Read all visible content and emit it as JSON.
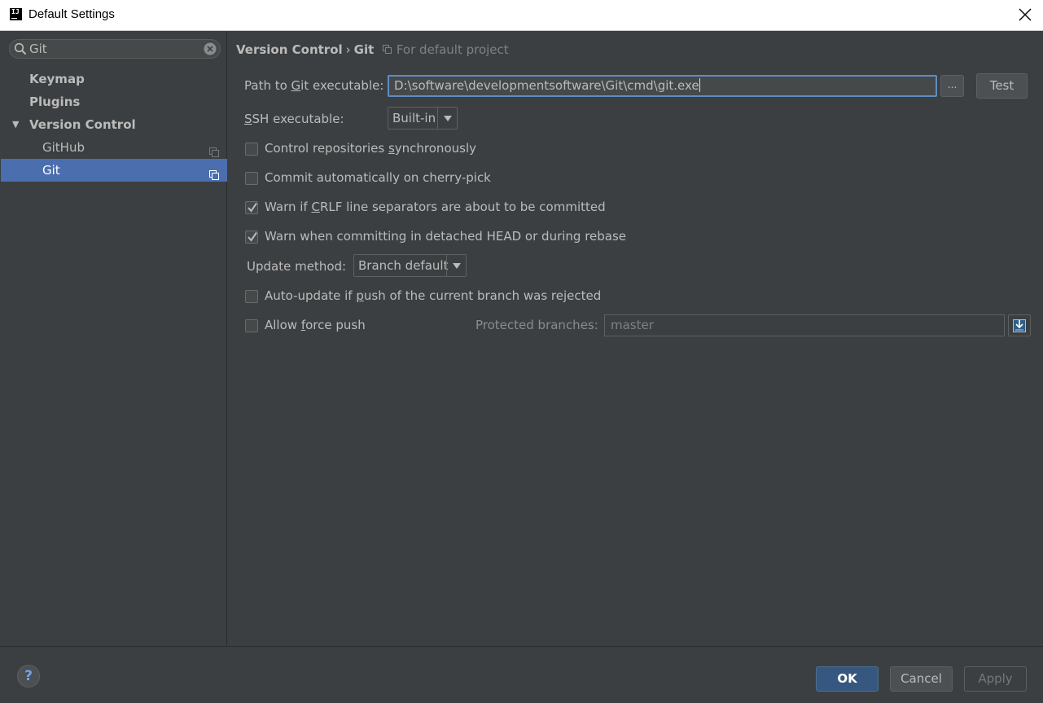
{
  "window": {
    "title": "Default Settings"
  },
  "search": {
    "value": "Git"
  },
  "sidebar": {
    "items": [
      {
        "label": "Keymap"
      },
      {
        "label": "Plugins"
      },
      {
        "label": "Version Control"
      },
      {
        "label": "GitHub"
      },
      {
        "label": "Git"
      }
    ]
  },
  "breadcrumb": {
    "section": "Version Control",
    "separator": "›",
    "page": "Git",
    "scope": "For default project"
  },
  "git": {
    "path_label_pre": "Path to ",
    "path_label_mnemonic": "G",
    "path_label_post": "it executable:",
    "path_value": "D:\\software\\developmentsoftware\\Git\\cmd\\git.exe",
    "browse_label": "...",
    "test_label": "Test",
    "ssh_label_mnemonic": "S",
    "ssh_label_post": "SH executable:",
    "ssh_value": "Built-in",
    "update_label": "Update method:",
    "update_value": "Branch default",
    "protected_label": "Protected branches:",
    "protected_value": "master"
  },
  "options": {
    "sync": {
      "pre": "Control repositories ",
      "mnemonic": "s",
      "post": "ynchronously",
      "checked": false
    },
    "cherry": {
      "label": "Commit automatically on cherry-pick",
      "checked": false
    },
    "crlf": {
      "pre": "Warn if ",
      "mnemonic": "C",
      "post": "RLF line separators are about to be committed",
      "checked": true
    },
    "detached": {
      "label": "Warn when committing in detached HEAD or during rebase",
      "checked": true
    },
    "autoupdate": {
      "pre": "Auto-update if ",
      "mnemonic": "p",
      "post": "ush of the current branch was rejected",
      "checked": false
    },
    "force": {
      "pre": "Allow ",
      "mnemonic": "f",
      "post": "orce push",
      "checked": false
    }
  },
  "footer": {
    "help_label": "?",
    "ok_label": "OK",
    "cancel_label": "Cancel",
    "apply_label": "Apply"
  },
  "colors": {
    "background": "#3c3f41",
    "selection": "#4b6eaf",
    "focus_border": "#5e8cc4",
    "ok_button": "#365880"
  }
}
